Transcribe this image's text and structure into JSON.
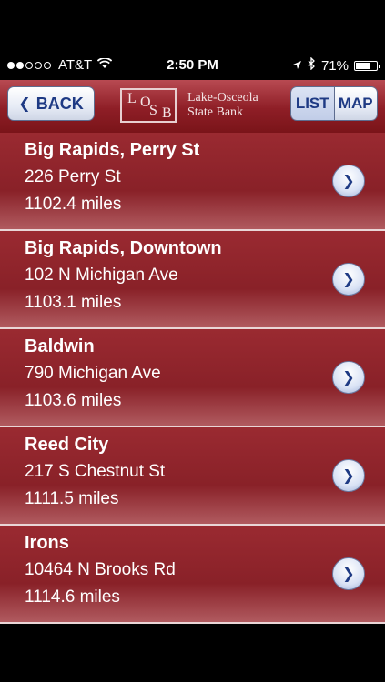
{
  "status_bar": {
    "carrier": "AT&T",
    "time": "2:50 PM",
    "battery_percent": "71%",
    "battery_level": 0.71,
    "signal_dots_filled": 2,
    "signal_dots_total": 5
  },
  "nav": {
    "back_label": "BACK",
    "logo_line1": "Lake-Osceola",
    "logo_line2": "State Bank",
    "logo_letters": "LOSB",
    "list_label": "LIST",
    "map_label": "MAP"
  },
  "locations": [
    {
      "name": "Big Rapids, Perry St",
      "address": "226 Perry St",
      "distance": "1102.4 miles"
    },
    {
      "name": "Big Rapids, Downtown",
      "address": "102 N Michigan Ave",
      "distance": "1103.1 miles"
    },
    {
      "name": "Baldwin",
      "address": "790 Michigan Ave",
      "distance": "1103.6 miles"
    },
    {
      "name": "Reed City",
      "address": "217 S Chestnut St",
      "distance": "1111.5 miles"
    },
    {
      "name": "Irons",
      "address": "10464 N Brooks Rd",
      "distance": "1114.6 miles"
    }
  ],
  "colors": {
    "navbar": "#8e1e26",
    "row": "#892128",
    "button_text": "#1e3a84"
  }
}
